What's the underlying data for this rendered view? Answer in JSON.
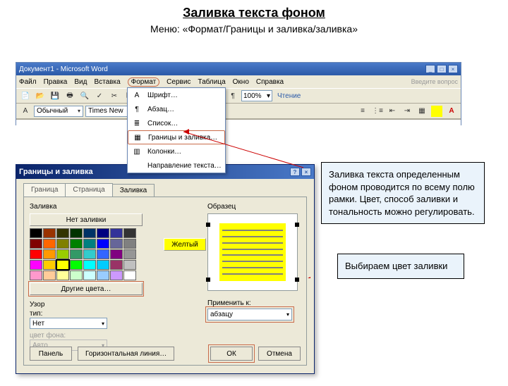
{
  "heading": "Заливка текста фоном",
  "subheading": "Меню: «Формат/Границы и заливка/заливка»",
  "word": {
    "title": "Документ1 - Microsoft Word",
    "ask_question": "Введите вопрос",
    "menu": {
      "file": "Файл",
      "edit": "Правка",
      "view": "Вид",
      "insert": "Вставка",
      "format": "Формат",
      "service": "Сервис",
      "table": "Таблица",
      "window": "Окно",
      "help": "Справка"
    },
    "style": "Обычный",
    "font": "Times New",
    "zoom": "100%",
    "reading": "Чтение"
  },
  "format_menu": {
    "items": [
      {
        "icon": "A",
        "label": "Шрифт…"
      },
      {
        "icon": "¶",
        "label": "Абзац…"
      },
      {
        "icon": "≣",
        "label": "Список…"
      },
      {
        "icon": "▦",
        "label": "Границы и заливка…",
        "hl": true
      },
      {
        "icon": "▥",
        "label": "Колонки…"
      },
      {
        "icon": "",
        "label": "Направление текста…"
      }
    ]
  },
  "dialog": {
    "title": "Границы и заливка",
    "tabs": {
      "border": "Граница",
      "page": "Страница",
      "fill": "Заливка"
    },
    "fill_label": "Заливка",
    "nofill": "Нет заливки",
    "color_name": "Желтый",
    "more_colors": "Другие цвета…",
    "pattern_label": "Узор",
    "pattern_type_label": "тип:",
    "pattern_type": "Нет",
    "pattern_color_label": "цвет фона:",
    "pattern_color": "Авто",
    "sample_label": "Образец",
    "apply_label": "Применить к:",
    "apply_value": "абзацу",
    "btn_panel": "Панель",
    "btn_hline": "Горизонтальная линия…",
    "btn_ok": "ОК",
    "btn_cancel": "Отмена"
  },
  "notes": {
    "n1": "Заливка текста определенным фоном проводится по всему полю рамки. Цвет, способ заливки и тональность можно регулировать.",
    "n2": "Выбираем цвет заливки"
  },
  "palette": [
    [
      "#000000",
      "#993300",
      "#333300",
      "#003300",
      "#003366",
      "#000080",
      "#333399",
      "#333333"
    ],
    [
      "#800000",
      "#ff6600",
      "#808000",
      "#008000",
      "#008080",
      "#0000ff",
      "#666699",
      "#808080"
    ],
    [
      "#ff0000",
      "#ff9900",
      "#99cc00",
      "#339966",
      "#33cccc",
      "#3366ff",
      "#800080",
      "#969696"
    ],
    [
      "#ff00ff",
      "#ffcc00",
      "#ffff00",
      "#00ff00",
      "#00ffff",
      "#00ccff",
      "#993366",
      "#c0c0c0"
    ],
    [
      "#ff99cc",
      "#ffcc99",
      "#ffff99",
      "#ccffcc",
      "#ccffff",
      "#99ccff",
      "#cc99ff",
      "#ffffff"
    ]
  ],
  "selected_swatch": "#ffff00"
}
